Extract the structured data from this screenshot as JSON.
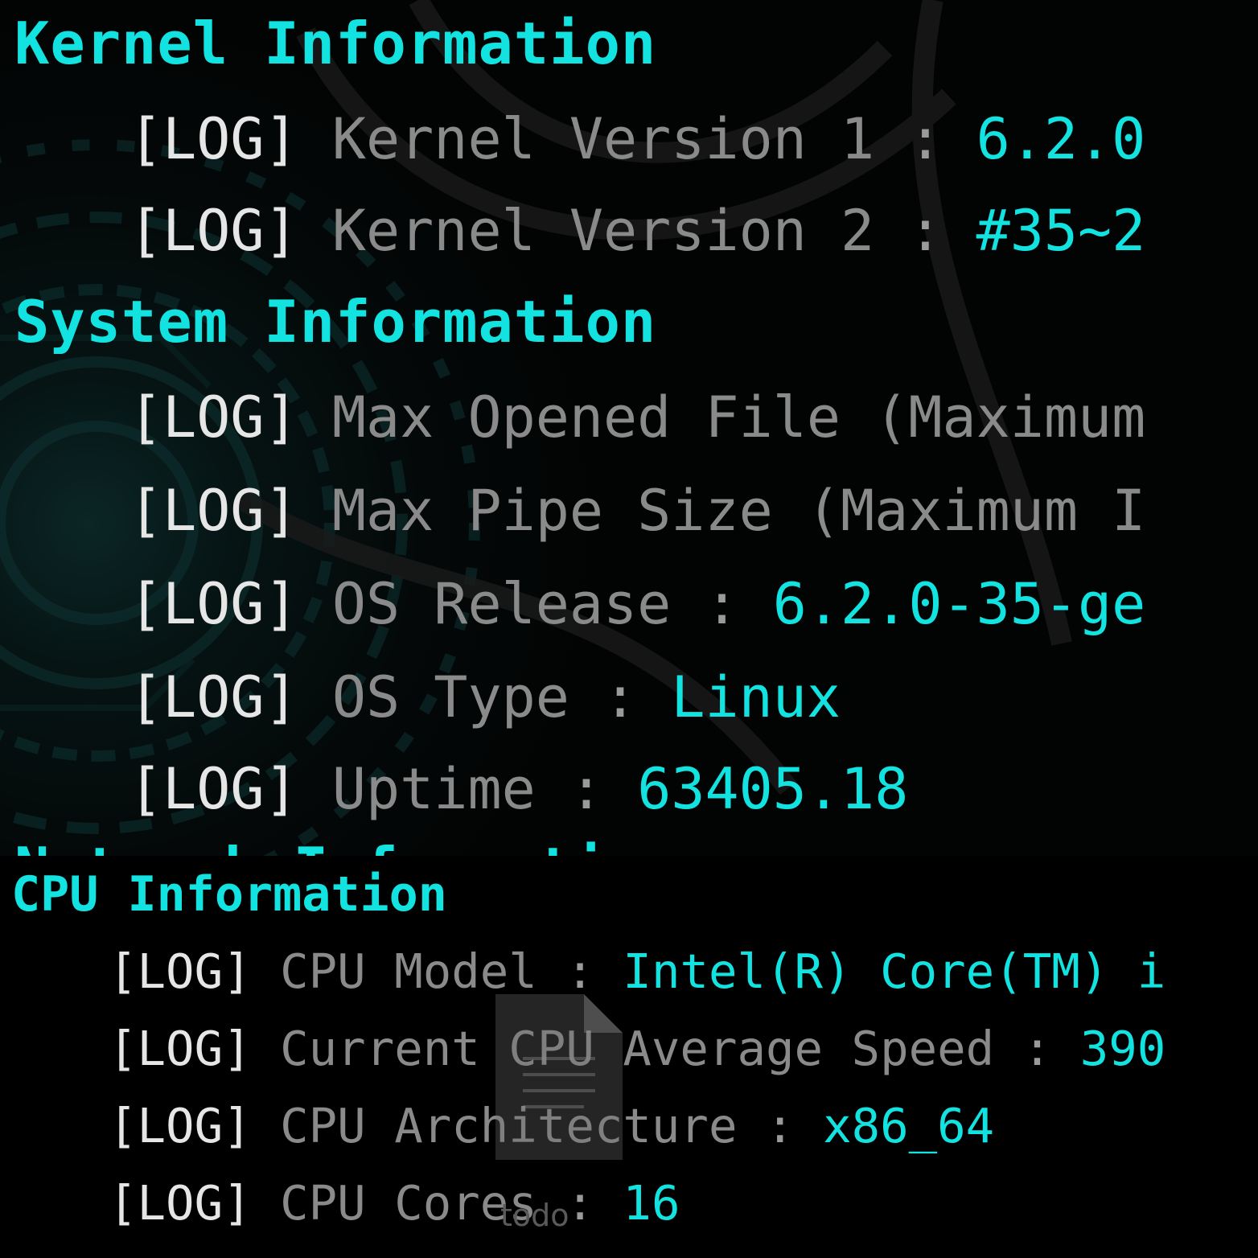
{
  "kernel_section": {
    "heading": "Kernel Information",
    "entries": [
      {
        "tag": "[LOG]",
        "key": "Kernel Version 1",
        "sep": " : ",
        "value": "6.2.0"
      },
      {
        "tag": "[LOG]",
        "key": "Kernel Version 2",
        "sep": " : ",
        "value": "#35~2"
      }
    ]
  },
  "system_section": {
    "heading": "System Information",
    "entries": [
      {
        "tag": "[LOG]",
        "key": "Max Opened File (Maximum",
        "sep": "",
        "value": ""
      },
      {
        "tag": "[LOG]",
        "key": "Max Pipe Size (Maximum I",
        "sep": "",
        "value": ""
      },
      {
        "tag": "[LOG]",
        "key": "OS Release",
        "sep": " : ",
        "value": "6.2.0-35-ge"
      },
      {
        "tag": "[LOG]",
        "key": "OS Type",
        "sep": " : ",
        "value": "Linux"
      },
      {
        "tag": "[LOG]",
        "key": "Uptime",
        "sep": " : ",
        "value": "63405.18"
      }
    ],
    "cut_off_heading": "Network Information"
  },
  "cpu_section": {
    "heading": "CPU Information",
    "entries": [
      {
        "tag": "[LOG]",
        "key": "CPU Model",
        "sep": " : ",
        "value": "Intel(R) Core(TM) i"
      },
      {
        "tag": "[LOG]",
        "key": "Current CPU Average Speed",
        "sep": " : ",
        "value": "390"
      },
      {
        "tag": "[LOG]",
        "key": "CPU Architecture",
        "sep": " : ",
        "value": "x86_64"
      },
      {
        "tag": "[LOG]",
        "key": "CPU Cores",
        "sep": " : ",
        "value": "16"
      }
    ]
  },
  "overlay_file": {
    "icon": "document-icon",
    "label": "todo"
  },
  "colors": {
    "heading": "#13e3e0",
    "tag": "#e6e6e6",
    "key": "#8a8a8a",
    "value": "#13e3e0",
    "background": "#000000"
  }
}
